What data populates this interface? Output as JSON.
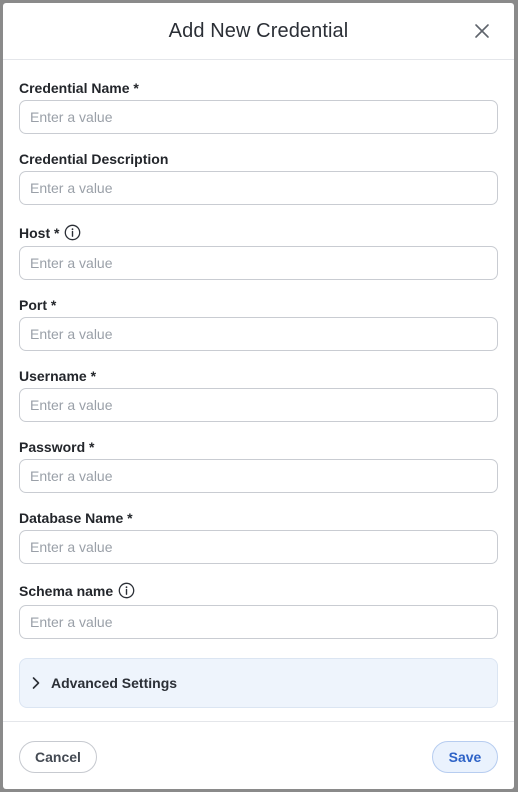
{
  "dialog": {
    "title": "Add New Credential"
  },
  "fields": [
    {
      "label": "Credential Name *",
      "placeholder": "Enter a value",
      "value": ""
    },
    {
      "label": "Credential Description",
      "placeholder": "Enter a value",
      "value": ""
    },
    {
      "label": "Host *",
      "placeholder": "Enter a value",
      "value": "",
      "info_icon": "info-icon"
    },
    {
      "label": "Port *",
      "placeholder": "Enter a value",
      "value": ""
    },
    {
      "label": "Username *",
      "placeholder": "Enter a value",
      "value": ""
    },
    {
      "label": "Password *",
      "placeholder": "Enter a value",
      "value": ""
    },
    {
      "label": "Database Name *",
      "placeholder": "Enter a value",
      "value": ""
    },
    {
      "label": "Schema name",
      "placeholder": "Enter a value",
      "value": "",
      "info_icon": "info-icon"
    }
  ],
  "advanced": {
    "label": "Advanced Settings",
    "icon": "chevron-right-icon"
  },
  "footer": {
    "cancel_label": "Cancel",
    "save_label": "Save"
  },
  "icons": {
    "close": "close-icon"
  },
  "colors": {
    "accent": "#2e63c7",
    "accent_bg": "#eaf2fd",
    "advanced_bg": "#eef4fc",
    "border": "#c9ccd2",
    "text": "#23262b",
    "placeholder": "#9aa0a8"
  }
}
